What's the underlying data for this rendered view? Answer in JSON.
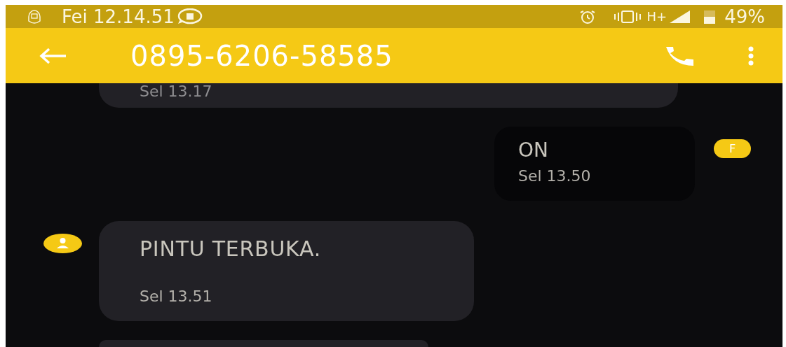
{
  "status_bar": {
    "time": "Fei 12.14.51",
    "network": "H+",
    "battery": "49%"
  },
  "header": {
    "title": "0895-6206-58585"
  },
  "messages": [
    {
      "kind": "incoming",
      "time": "Sel 13.17",
      "partial": true
    },
    {
      "kind": "outgoing",
      "text": "ON",
      "time": "Sel 13.50",
      "avatar": "F"
    },
    {
      "kind": "incoming",
      "text": "PINTU TERBUKA.",
      "time": "Sel 13.51"
    },
    {
      "kind": "incoming",
      "partial": true
    }
  ]
}
